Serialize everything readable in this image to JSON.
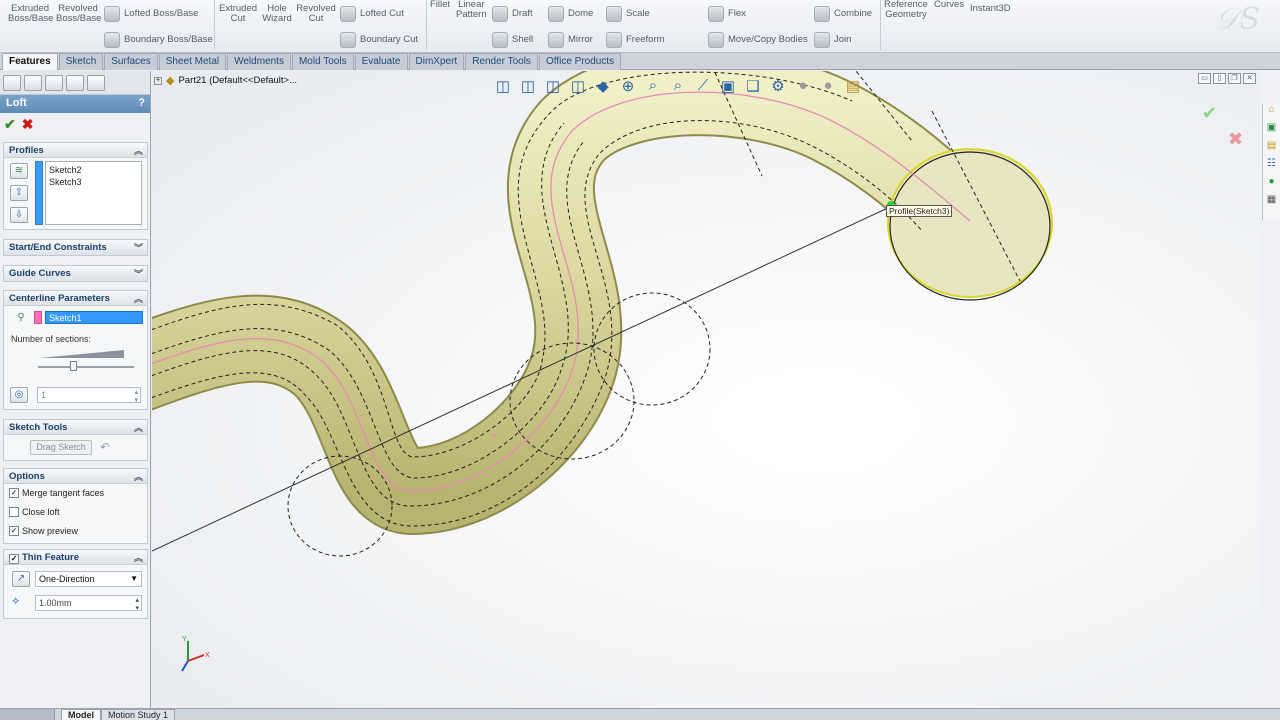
{
  "ribbon": {
    "extruded_boss": "Extruded\nBoss/Base",
    "revolved_boss": "Revolved\nBoss/Base",
    "lofted_boss": "Lofted Boss/Base",
    "boundary_boss": "Boundary Boss/Base",
    "extruded_cut": "Extruded\nCut",
    "hole_wizard": "Hole\nWizard",
    "revolved_cut": "Revolved\nCut",
    "lofted_cut": "Lofted Cut",
    "boundary_cut": "Boundary Cut",
    "fillet": "Fillet",
    "linear_pattern": "Linear\nPattern",
    "draft": "Draft",
    "shell": "Shell",
    "dome": "Dome",
    "mirror": "Mirror",
    "scale": "Scale",
    "freeform": "Freeform",
    "flex": "Flex",
    "move_copy": "Move/Copy Bodies",
    "combine": "Combine",
    "join": "Join",
    "reference_geometry": "Reference\nGeometry",
    "curves": "Curves",
    "instant3d": "Instant3D"
  },
  "tabs": [
    "Features",
    "Sketch",
    "Surfaces",
    "Sheet Metal",
    "Weldments",
    "Mold Tools",
    "Evaluate",
    "DimXpert",
    "Render Tools",
    "Office Products"
  ],
  "pm": {
    "title": "Loft",
    "help": "?",
    "profiles": {
      "header": "Profiles",
      "items": [
        "Sketch2",
        "Sketch3"
      ]
    },
    "start_end": "Start/End Constraints",
    "guide_curves": "Guide Curves",
    "centerline": {
      "header": "Centerline Parameters",
      "selected": "Sketch1",
      "sections_label": "Number of sections:",
      "sections_value": "1"
    },
    "sketch_tools": {
      "header": "Sketch Tools",
      "drag_sketch": "Drag Sketch"
    },
    "options": {
      "header": "Options",
      "merge": "Merge tangent faces",
      "close": "Close loft",
      "preview": "Show preview",
      "merge_checked": true,
      "close_checked": false,
      "preview_checked": true
    },
    "thin": {
      "header": "Thin Feature",
      "direction": "One-Direction",
      "thickness": "1.00mm",
      "checked": true
    }
  },
  "viewport": {
    "tree_label": "Part21  (Default<<Default>...",
    "callout": "Profile(Sketch3)"
  },
  "status": {
    "model": "Model",
    "motion": "Motion Study 1"
  },
  "colors": {
    "body": "#d8d49a",
    "accent": "#5f8cb6",
    "select": "#3399ff"
  }
}
